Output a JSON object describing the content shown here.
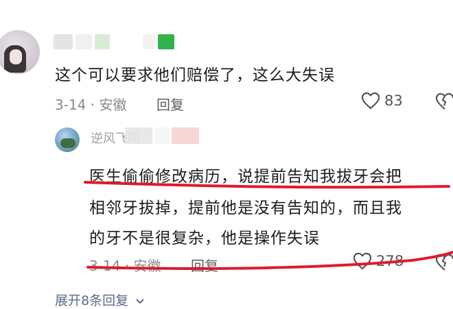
{
  "comment1": {
    "text": "这个可以要求他们赔偿了，这么大失误",
    "meta": "3-14 · 安徽",
    "reply_label": "回复",
    "likes": "83"
  },
  "comment2": {
    "name_visible": "逆风飞翔",
    "lines": [
      "医生偷偷修改病历，说提前告知我拔牙会把",
      "相邻牙拔掉，提前他是没有告知的，而且我",
      "的牙不是很复杂，他是操作失误"
    ],
    "meta": "3-14 · 安徽",
    "reply_label": "回复",
    "likes": "278"
  },
  "expand_label": "展开8条回复",
  "colors": {
    "annotation_red": "#e0192d",
    "heart_outline": "#555555",
    "blur_green": "#34a853"
  },
  "icons": [
    "heart-outline-icon",
    "broken-heart-icon",
    "chevron-down-icon"
  ]
}
